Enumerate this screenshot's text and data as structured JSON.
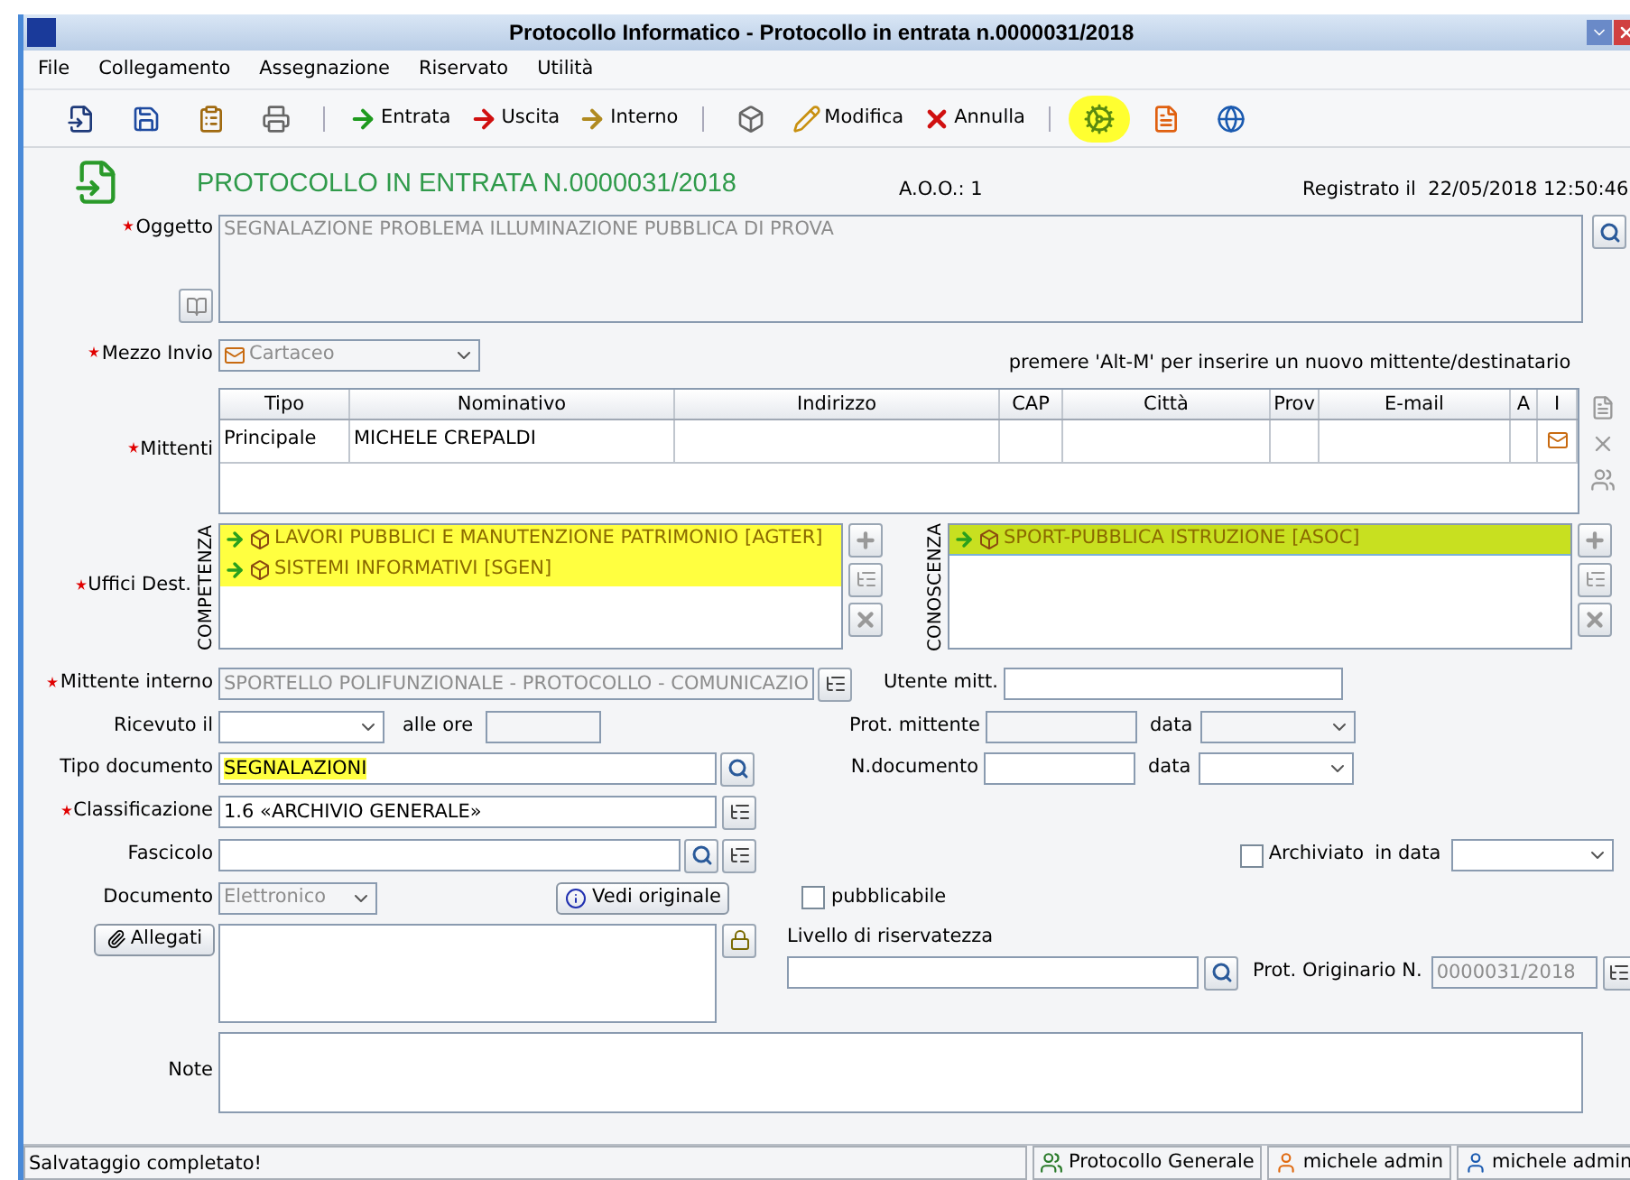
{
  "window": {
    "title": "Protocollo Informatico - Protocollo in entrata n.0000031/2018"
  },
  "menu": [
    {
      "label": "File"
    },
    {
      "label": "Collegamento"
    },
    {
      "label": "Assegnazione"
    },
    {
      "label": "Riservato"
    },
    {
      "label": "Utilità"
    }
  ],
  "toolbar": [
    {
      "kind": "icon",
      "highlighted": false
    },
    {
      "kind": "icon",
      "highlighted": false
    },
    {
      "kind": "icon",
      "highlighted": false
    },
    {
      "kind": "icon",
      "highlighted": false
    },
    {
      "kind": "separator"
    },
    {
      "kind": "button",
      "label": "Entrata",
      "highlighted": false
    },
    {
      "kind": "button",
      "label": "Uscita",
      "highlighted": false
    },
    {
      "kind": "button",
      "label": "Interno",
      "highlighted": false
    },
    {
      "kind": "separator"
    },
    {
      "kind": "icon",
      "highlighted": false
    },
    {
      "kind": "button",
      "label": "Modifica",
      "highlighted": false
    },
    {
      "kind": "button",
      "label": "Annulla",
      "highlighted": false
    },
    {
      "kind": "separator"
    },
    {
      "kind": "icon",
      "highlighted": true
    },
    {
      "kind": "icon",
      "highlighted": false
    },
    {
      "kind": "icon",
      "highlighted": false
    }
  ],
  "header": {
    "title": "PROTOCOLLO IN ENTRATA N.0000031/2018",
    "aoo": "A.O.O.: 1",
    "registered": "Registrato il  22/05/2018 12:50:46"
  },
  "oggetto": {
    "label": "Oggetto",
    "required": true,
    "disabled": true,
    "value": "SEGNALAZIONE PROBLEMA ILLUMINAZIONE PUBBLICA DI PROVA"
  },
  "mezzo_invio": {
    "label": "Mezzo Invio",
    "required": true,
    "value": "Cartaceo",
    "disabled": true
  },
  "hint": "premere 'Alt-M' per inserire un nuovo mittente/destinatario",
  "mittenti": {
    "label": "Mittenti",
    "required": true,
    "columns": [
      "Tipo",
      "Nominativo",
      "Indirizzo",
      "CAP",
      "Città",
      "Prov",
      "E-mail",
      "A",
      "I"
    ],
    "rows": [
      {
        "cells": [
          "Principale",
          "MICHELE CREPALDI",
          "",
          "",
          "",
          "",
          "",
          "",
          ""
        ]
      }
    ]
  },
  "uffici": {
    "label": "Uffici Dest.",
    "required": true,
    "competenza": {
      "label": "COMPETENZA",
      "items": [
        {
          "label": "LAVORI PUBBLICI E MANUTENZIONE PATRIMONIO [AGTER]",
          "highlighted": true,
          "selected": false
        },
        {
          "label": "SISTEMI INFORMATIVI [SGEN]",
          "highlighted": true,
          "selected": false
        }
      ]
    },
    "conoscenza": {
      "label": "CONOSCENZA",
      "items": [
        {
          "label": "SPORT-PUBBLICA ISTRUZIONE [ASOC]",
          "highlighted": true,
          "selected": true
        }
      ]
    }
  },
  "mittente_interno": {
    "label": "Mittente interno",
    "required": true,
    "value": "SPORTELLO POLIFUNZIONALE - PROTOCOLLO - COMUNICAZIO",
    "disabled": true
  },
  "utente_mitt": {
    "label": "Utente mitt."
  },
  "ricevuto": {
    "label": "Ricevuto il",
    "time_label": "alle ore"
  },
  "prot_mittente": {
    "label": "Prot. mittente",
    "date_label": "data"
  },
  "tipo_documento": {
    "label": "Tipo documento",
    "value": "SEGNALAZIONI",
    "highlighted": true
  },
  "n_documento": {
    "label": "N.documento",
    "date_label": "data"
  },
  "classificazione": {
    "label": "Classificazione",
    "required": true,
    "value": "1.6 «ARCHIVIO GENERALE»"
  },
  "fascicolo": {
    "label": "Fascicolo"
  },
  "archiviato": {
    "label": "Archiviato",
    "checked": false,
    "date_label": "in data"
  },
  "documento": {
    "label": "Documento",
    "value": "Elettronico",
    "disabled": true
  },
  "vedi_originale": {
    "label": "Vedi originale"
  },
  "pubblicabile": {
    "label": "pubblicabile",
    "checked": false
  },
  "allegati": {
    "label": "Allegati"
  },
  "livello": {
    "label": "Livello di riservatezza"
  },
  "prot_originario": {
    "label": "Prot. Originario N.",
    "value": "0000031/2018",
    "disabled": true
  },
  "note": {
    "label": "Note"
  },
  "status_bar": {
    "message": "Salvataggio completato!",
    "panels": [
      "Protocollo Generale",
      "michele admin",
      "michele admin"
    ]
  }
}
